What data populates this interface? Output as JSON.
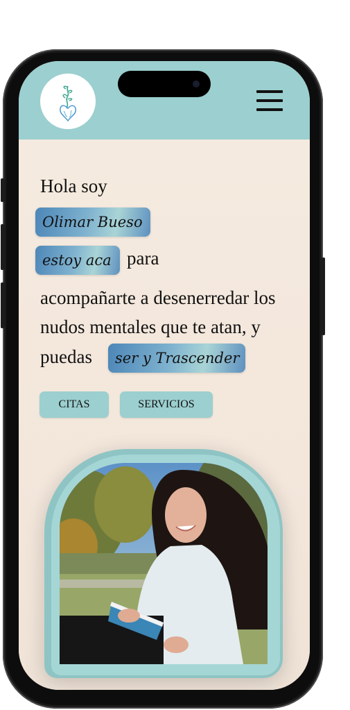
{
  "header": {
    "logo_icon": "heart-leaf-logo-icon",
    "menu_icon": "hamburger-menu-icon"
  },
  "hero": {
    "intro": "Hola soy",
    "name_pill": "Olimar Bueso",
    "estoy_pill": "estoy aca",
    "para": "para",
    "line1": "acompañarte a desenerredar los",
    "line2": "nudos mentales que te atan, y",
    "line3": "puedas",
    "trascender_pill": "ser y Trascender"
  },
  "buttons": {
    "citas": "CITAS",
    "servicios": "SERVICIOS"
  },
  "colors": {
    "header_bg": "#9ccfcf",
    "page_bg": "#f4e9df",
    "pill_blue": "#4d87b8",
    "frame_teal": "#8fc4c4"
  }
}
